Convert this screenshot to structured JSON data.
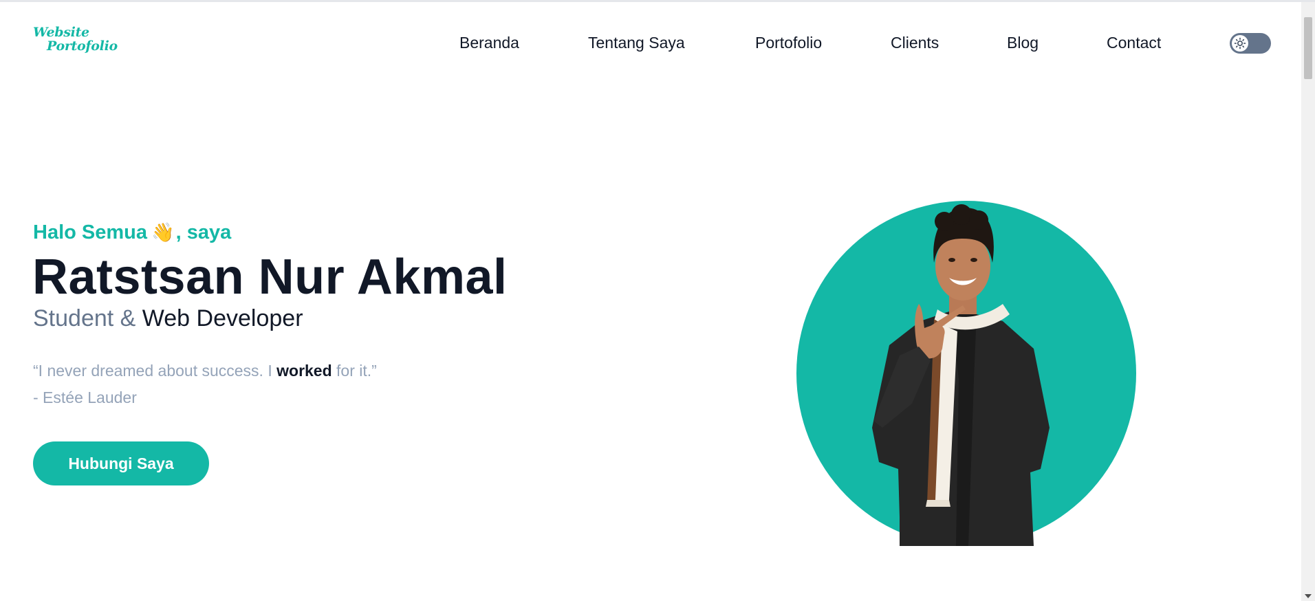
{
  "header": {
    "logo": {
      "line1": "Website",
      "line2": "Portofolio"
    },
    "nav": [
      {
        "label": "Beranda"
      },
      {
        "label": "Tentang Saya"
      },
      {
        "label": "Portofolio"
      },
      {
        "label": "Clients"
      },
      {
        "label": "Blog"
      },
      {
        "label": "Contact"
      }
    ],
    "theme_toggle_icon": "sun-icon"
  },
  "hero": {
    "greeting_before": "Halo Semua",
    "greeting_emoji": "👋",
    "greeting_after": ", saya",
    "name": "Ratstsan Nur Akmal",
    "role_part1": "Student",
    "role_amp": " & ",
    "role_part2": "Web Developer",
    "quote_before": "“I never dreamed about success. I ",
    "quote_bold": "worked",
    "quote_after": " for it.”",
    "quote_author": "- Estée Lauder",
    "cta_label": "Hubungi Saya"
  },
  "colors": {
    "accent": "#14b8a6",
    "text": "#111827",
    "muted": "#64748b",
    "quote": "#94a3b8"
  }
}
